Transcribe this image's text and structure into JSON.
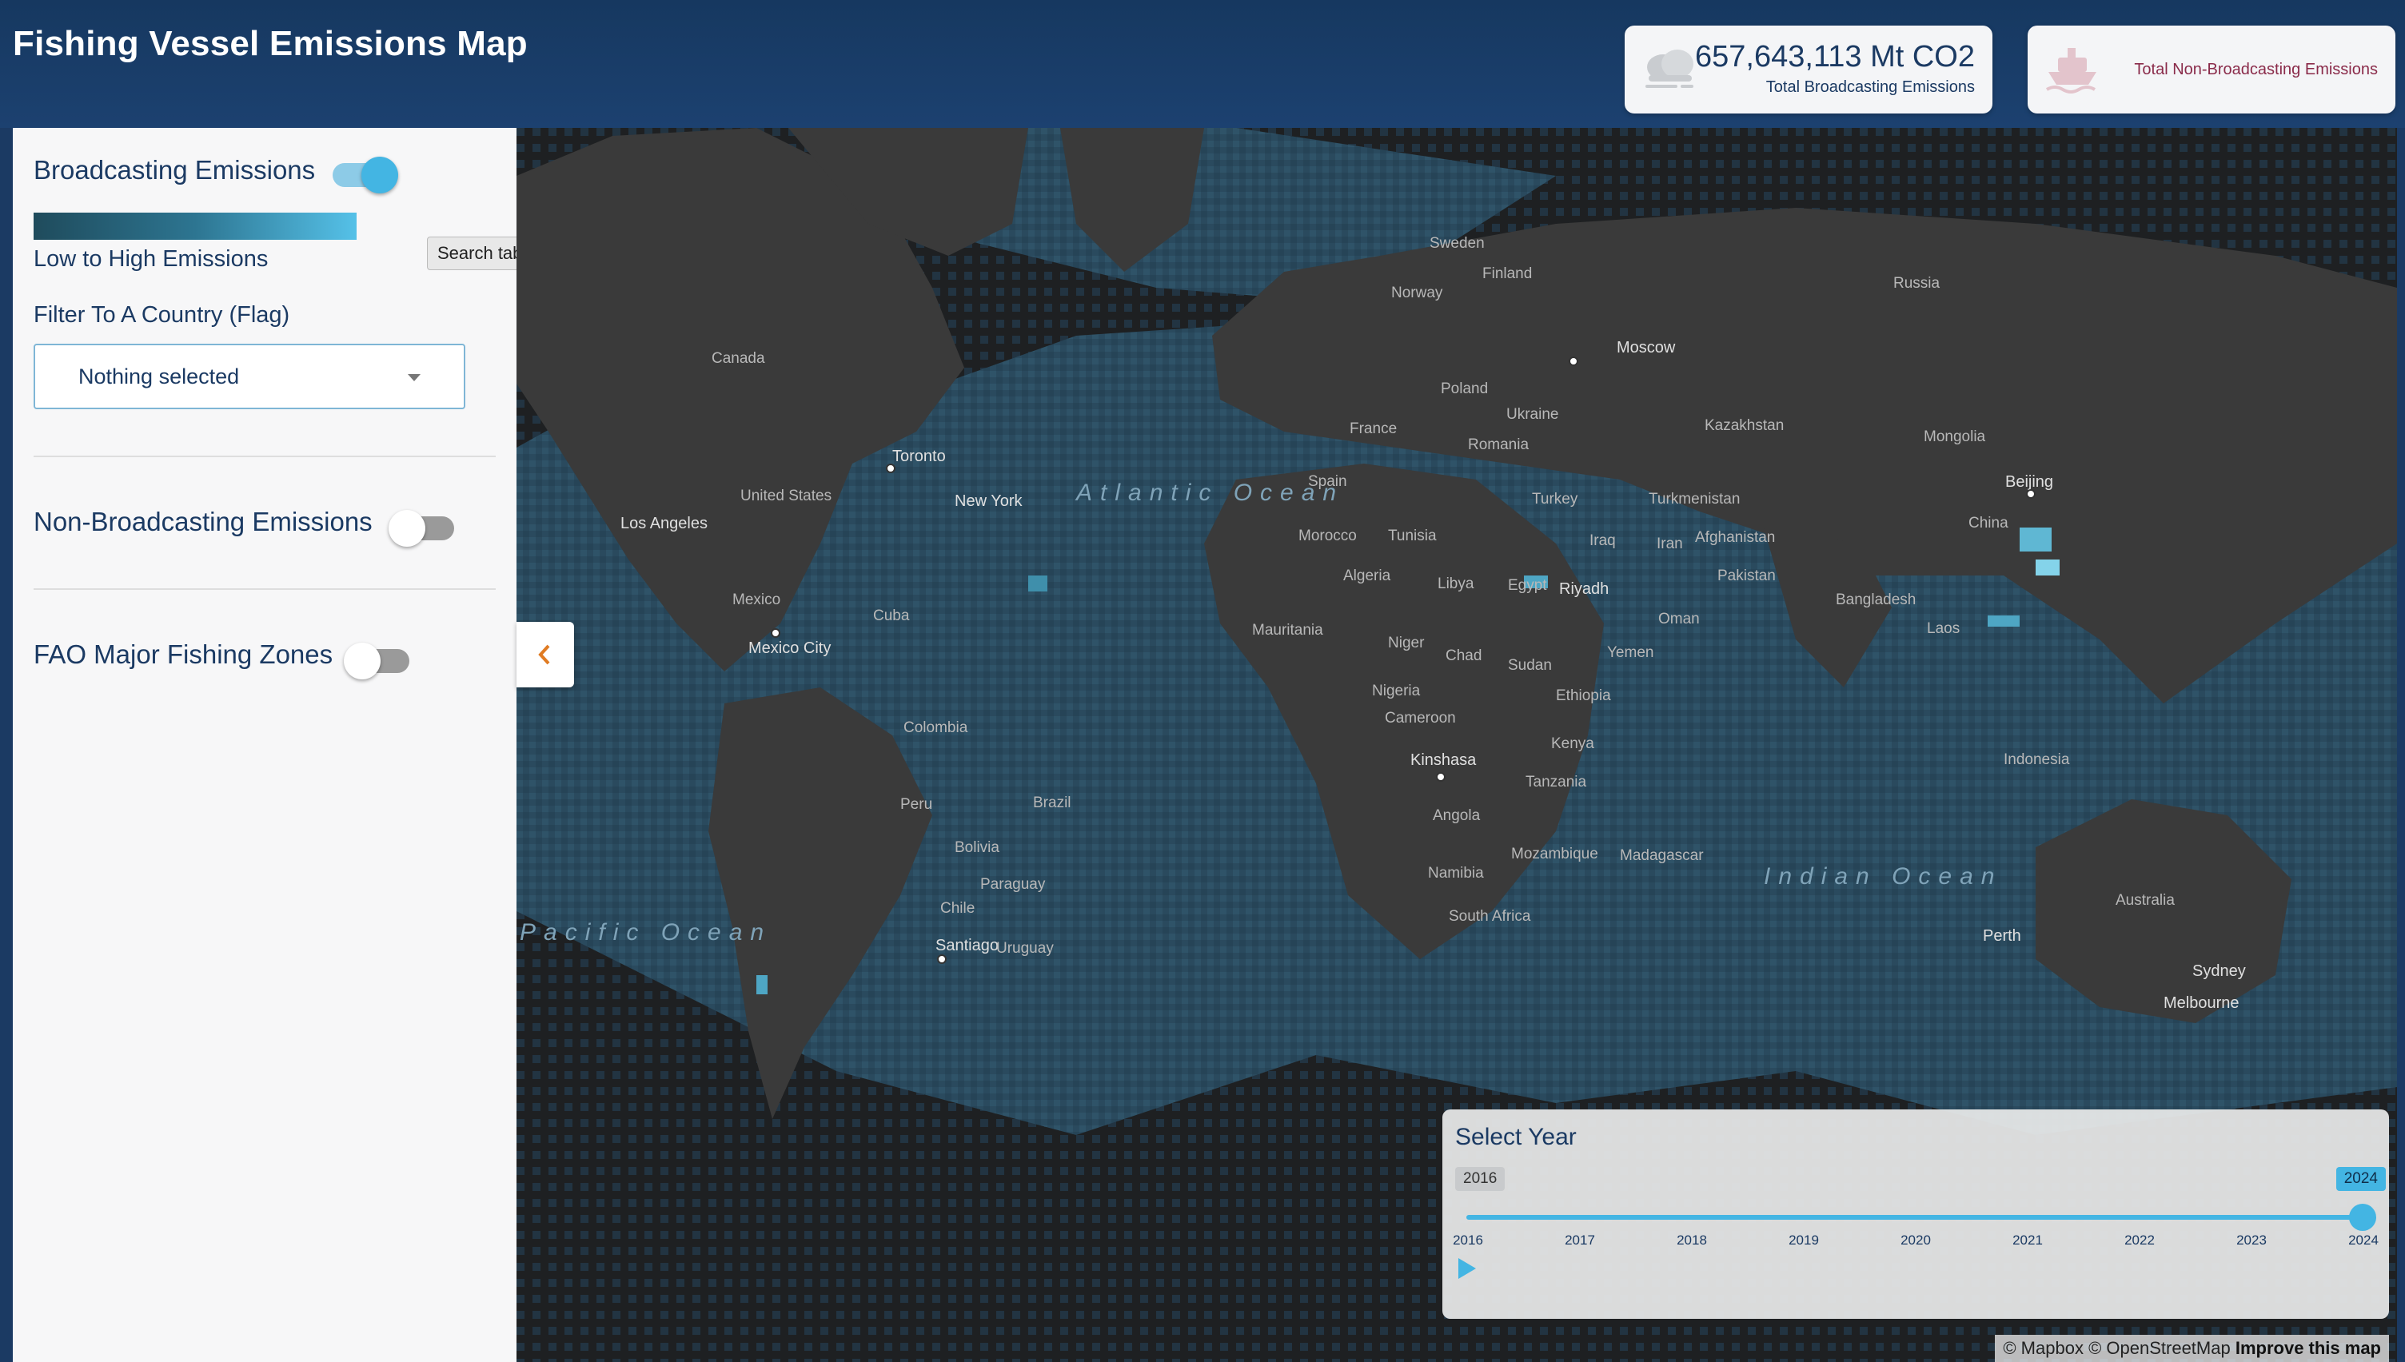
{
  "header": {
    "title": "Fishing Vessel Emissions Map",
    "broadcasting_card": {
      "value": "657,643,113 Mt CO2",
      "label": "Total Broadcasting Emissions",
      "icon": "cloud-icon"
    },
    "non_broadcasting_card": {
      "value": "",
      "label": "Total Non-Broadcasting Emissions",
      "icon": "ship-icon"
    }
  },
  "sidebar": {
    "broadcasting": {
      "label": "Broadcasting Emissions",
      "enabled": true
    },
    "legend_label": "Low to High Emissions",
    "filter_label": "Filter To A Country (Flag)",
    "country_select": {
      "value": "Nothing selected"
    },
    "non_broadcasting": {
      "label": "Non-Broadcasting Emissions",
      "enabled": false
    },
    "fao": {
      "label": "FAO Major Fishing Zones",
      "enabled": false
    }
  },
  "tooltip": "Search tabs",
  "map": {
    "labels": [
      "Canada",
      "United States",
      "Los Angeles",
      "Toronto",
      "Mexico",
      "Mexico City",
      "Cuba",
      "Russia",
      "Moscow",
      "Sweden",
      "Finland",
      "Norway",
      "Poland",
      "Ukraine",
      "Romania",
      "France",
      "Spain",
      "Turkey",
      "Kazakhstan",
      "Mongolia",
      "Beijing",
      "China",
      "Turkmenistan",
      "Afghanistan",
      "Pakistan",
      "Iran",
      "Iraq",
      "Riyadh",
      "Yemen",
      "Oman",
      "Bangladesh",
      "Laos",
      "Indonesia",
      "Algeria",
      "Libya",
      "Egypt",
      "Mauritania",
      "Niger",
      "Chad",
      "Sudan",
      "Nigeria",
      "Ethiopia",
      "Cameroon",
      "Kinshasa",
      "Kenya",
      "Tanzania",
      "Angola",
      "Namibia",
      "Mozambique",
      "South Africa",
      "Colombia",
      "Peru",
      "Brazil",
      "Bolivia",
      "Paraguay",
      "Chile",
      "Santiago",
      "Uruguay",
      "Australia",
      "Perth",
      "Sydney",
      "Melbourne",
      "New York",
      "Morocco",
      "Tunisia",
      "Madagascar"
    ],
    "oceans": [
      "Atlantic Ocean",
      "Pacific Ocean",
      "Indian Ocean"
    ],
    "attribution": {
      "mapbox": "© Mapbox",
      "osm": "© OpenStreetMap",
      "improve": "Improve this map"
    }
  },
  "year_selector": {
    "title": "Select Year",
    "from": "2016",
    "to": "2024",
    "ticks": [
      "2016",
      "2017",
      "2018",
      "2019",
      "2020",
      "2021",
      "2022",
      "2023",
      "2024"
    ],
    "selected": "2024"
  },
  "colors": {
    "header": "#1b3a63",
    "accent": "#43b5e3",
    "map_bg": "#1e1f20",
    "land": "#3a3a3a",
    "ocean_emission": "#2a4a5e"
  }
}
